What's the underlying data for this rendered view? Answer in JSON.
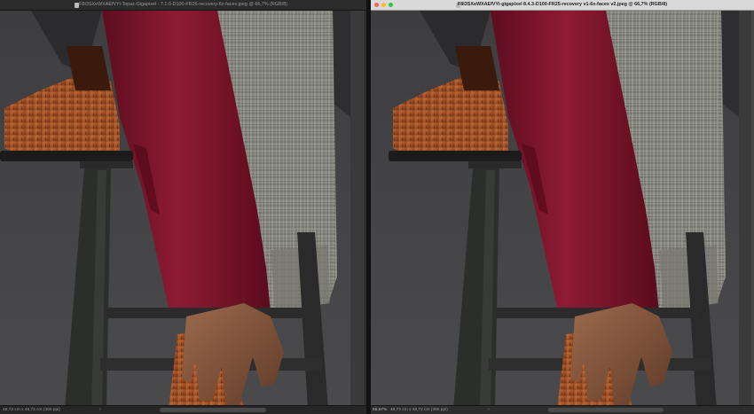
{
  "left_window": {
    "title": "F8I3SXeWXAEfVYi-Topaz-Gigapixel - 7.1.0-D100-FR26-recovery-6x-facex.jpeg @ 66,7% (RGB/8)",
    "status_doc_size": "48,72 cm x 48,72 cm (300 ppi)"
  },
  "right_window": {
    "title": "F8I3SXeWXAEfVYi-gigapixel 8.4.3-D100-FR25-recovery v1-6x-facex v2.jpeg @ 66,7% (RGB/8)",
    "zoom": "66,67%",
    "status_doc_size": "48,72 cm x 48,72 cm (300 ppi)"
  }
}
